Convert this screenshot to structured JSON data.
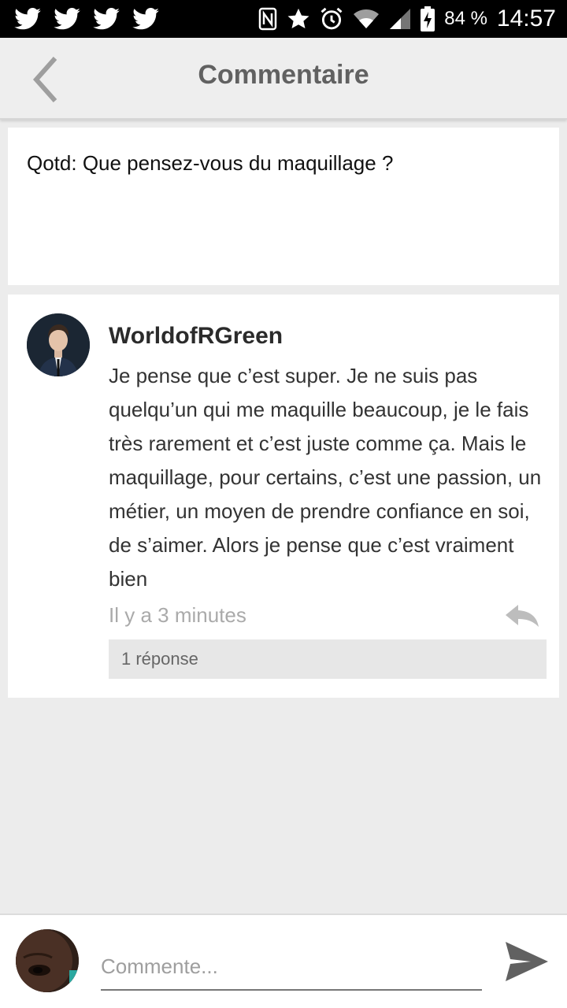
{
  "status_bar": {
    "battery": "84 %",
    "time": "14:57",
    "notification_icons": [
      "twitter-icon",
      "twitter-icon",
      "twitter-icon",
      "twitter-icon"
    ],
    "system_icons": [
      "nfc-icon",
      "star-icon",
      "alarm-icon",
      "wifi-icon",
      "signal-icon",
      "battery-charging-icon"
    ]
  },
  "header": {
    "title": "Commentaire",
    "back_icon": "chevron-left-icon"
  },
  "post": {
    "text": "Qotd: Que pensez-vous du maquillage ?"
  },
  "comment": {
    "username": "WorldofRGreen",
    "text": "Je pense que c’est super. Je ne suis pas quelqu’un qui me maquille beaucoup, je le fais très rarement et c’est juste comme ça. Mais le maquillage, pour certains, c’est une passion, un métier, un moyen de prendre confiance en soi, de s’aimer. Alors je pense que c’est vraiment bien",
    "timestamp": "Il y a 3 minutes",
    "replies_label": "1 réponse"
  },
  "composer": {
    "placeholder": "Commente...",
    "value": ""
  },
  "colors": {
    "background": "#ececec",
    "header_title": "#616161",
    "timestamp": "#aaaaaa",
    "replies_bg": "#e7e7e7"
  }
}
